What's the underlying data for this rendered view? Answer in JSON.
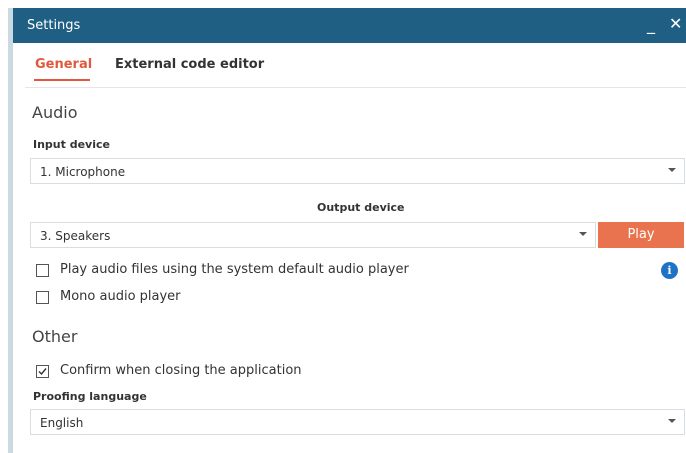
{
  "window": {
    "title": "Settings",
    "minimize_glyph": "_",
    "close_glyph": "✕"
  },
  "tabs": [
    {
      "label": "General",
      "active": true
    },
    {
      "label": "External code editor",
      "active": false
    }
  ],
  "audio": {
    "section_title": "Audio",
    "input_device": {
      "label": "Input device",
      "value": "1. Microphone"
    },
    "output_device": {
      "label": "Output device",
      "value": "3. Speakers"
    },
    "play_label": "Play",
    "play_default_player": {
      "label": "Play audio files using the system default audio player",
      "checked": false
    },
    "mono_player": {
      "label": "Mono audio player",
      "checked": false
    }
  },
  "other": {
    "section_title": "Other",
    "confirm_close": {
      "label": "Confirm when closing the application",
      "checked": true
    },
    "proofing_language": {
      "label": "Proofing language",
      "value": "English"
    }
  },
  "colors": {
    "titlebar": "#1f5f84",
    "accent": "#e2583c",
    "play_button": "#e9734f",
    "info_icon": "#1f73c6"
  },
  "icons": {
    "minimize": "minimize-icon",
    "close": "close-icon",
    "info": "info-icon",
    "dropdown": "chevron-down-icon",
    "checkbox": "checkbox-icon"
  }
}
